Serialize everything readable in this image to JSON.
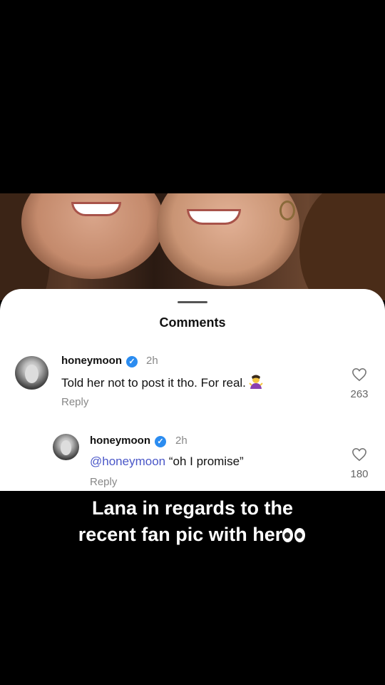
{
  "sheet": {
    "title": "Comments"
  },
  "comments": [
    {
      "username": "honeymoon",
      "time": "2h",
      "text": "Told her not to post it tho. For real.",
      "emoji": "person-shrugging-emoji",
      "reply_label": "Reply",
      "likes": "263"
    },
    {
      "username": "honeymoon",
      "time": "2h",
      "mention": "@honeymoon",
      "text": " “oh I promise”",
      "reply_label": "Reply",
      "likes": "180"
    }
  ],
  "caption": {
    "line1": "Lana in regards to the",
    "line2": "recent fan pic with her",
    "emoji": "eyes-emoji"
  },
  "colors": {
    "verified": "#2b8cf0",
    "mention": "#4a57c8"
  }
}
